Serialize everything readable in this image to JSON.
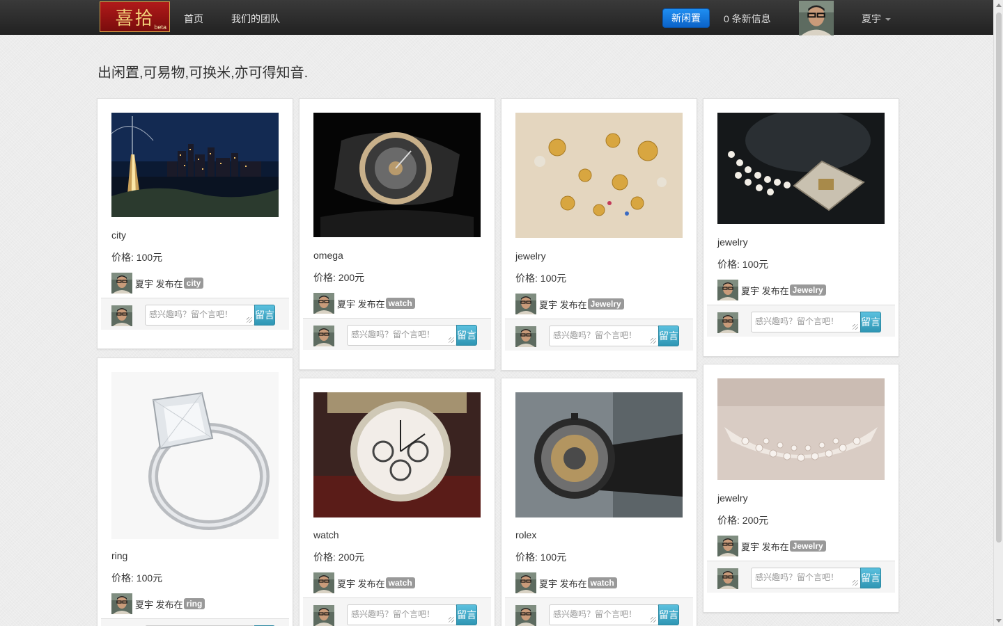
{
  "navbar": {
    "logo_text": "喜拾",
    "logo_beta": "beta",
    "links": [
      "首页",
      "我们的团队"
    ],
    "new_button": "新闲置",
    "messages": "0 条新信息",
    "username": "夏宇"
  },
  "tagline": "出闲置,可易物,可换米,亦可得知音.",
  "post_prefix": "发布在",
  "comment_placeholder": "感兴趣吗？留个言吧！",
  "comment_button": "留言",
  "items": [
    {
      "title": "city",
      "price": "价格: 100元",
      "user": "夏宇",
      "tag": "city"
    },
    {
      "title": "omega",
      "price": "价格: 200元",
      "user": "夏宇",
      "tag": "watch"
    },
    {
      "title": "jewelry",
      "price": "价格: 100元",
      "user": "夏宇",
      "tag": "Jewelry"
    },
    {
      "title": "jewelry",
      "price": "价格: 100元",
      "user": "夏宇",
      "tag": "Jewelry"
    },
    {
      "title": "ring",
      "price": "价格: 100元",
      "user": "夏宇",
      "tag": "ring"
    },
    {
      "title": "watch",
      "price": "价格: 200元",
      "user": "夏宇",
      "tag": "watch"
    },
    {
      "title": "rolex",
      "price": "价格: 100元",
      "user": "夏宇",
      "tag": "watch"
    },
    {
      "title": "jewelry",
      "price": "价格: 200元",
      "user": "夏宇",
      "tag": "Jewelry"
    }
  ],
  "colors": {
    "accent": "#0b63c9",
    "navbar": "#2a2a2a",
    "badge": "#999999",
    "comment_button": "#3ba6c8"
  }
}
